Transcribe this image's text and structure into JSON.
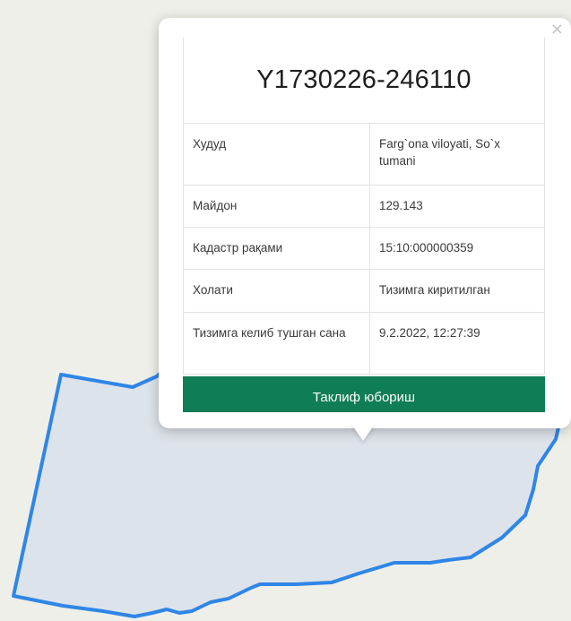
{
  "popup": {
    "close_icon": "×",
    "title": "Y1730226-246110",
    "rows": [
      {
        "label": "Худуд",
        "value": "Farg`ona viloyati, So`x tumani"
      },
      {
        "label": "Майдон",
        "value": "129.143"
      },
      {
        "label": "Кадастр рақами",
        "value": "15:10:000000359"
      },
      {
        "label": "Холати",
        "value": "Тизимга киритилган"
      },
      {
        "label": "Тизимга келиб тушган сана",
        "value": "9.2.2022, 12:27:39"
      }
    ],
    "button_label": "Таклиф юбориш"
  },
  "map": {
    "background_color": "#efefea",
    "parcel_fill_color": "#dde3ea",
    "parcel_stroke_color": "#2f86e6",
    "button_color": "#0f7d55"
  }
}
